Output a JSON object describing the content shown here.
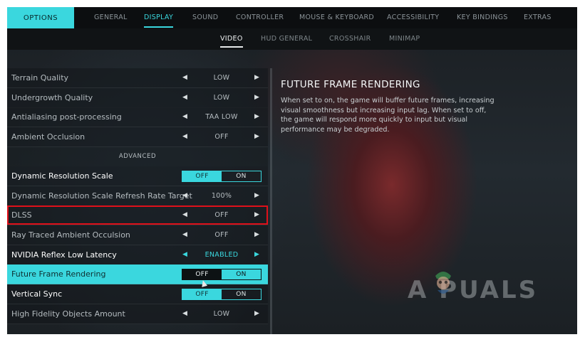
{
  "header": {
    "options_label": "OPTIONS",
    "tabs": [
      {
        "label": "GENERAL",
        "active": false
      },
      {
        "label": "DISPLAY",
        "active": true
      },
      {
        "label": "SOUND",
        "active": false
      },
      {
        "label": "CONTROLLER",
        "active": false
      },
      {
        "label": "MOUSE & KEYBOARD",
        "active": false
      },
      {
        "label": "ACCESSIBILITY",
        "active": false
      },
      {
        "label": "KEY BINDINGS",
        "active": false
      },
      {
        "label": "EXTRAS",
        "active": false
      }
    ],
    "subtabs": [
      {
        "label": "VIDEO",
        "active": true
      },
      {
        "label": "HUD GENERAL",
        "active": false
      },
      {
        "label": "CROSSHAIR",
        "active": false
      },
      {
        "label": "MINIMAP",
        "active": false
      }
    ]
  },
  "settings": {
    "terrain_quality": {
      "label": "Terrain Quality",
      "value": "LOW"
    },
    "undergrowth_quality": {
      "label": "Undergrowth Quality",
      "value": "LOW"
    },
    "antialiasing": {
      "label": "Antialiasing post-processing",
      "value": "TAA LOW"
    },
    "ambient_occlusion": {
      "label": "Ambient Occlusion",
      "value": "OFF"
    },
    "advanced_header": "ADVANCED",
    "dynamic_resolution_scale": {
      "label": "Dynamic Resolution Scale",
      "off": "OFF",
      "on": "ON",
      "selected": "OFF"
    },
    "drs_refresh_target": {
      "label": "Dynamic Resolution Scale Refresh Rate Target",
      "value": "100%"
    },
    "dlss": {
      "label": "DLSS",
      "value": "OFF"
    },
    "ray_traced_ao": {
      "label": "Ray Traced Ambient Occulsion",
      "value": "OFF"
    },
    "nvidia_reflex": {
      "label": "NVIDIA Reflex Low Latency",
      "value": "ENABLED"
    },
    "future_frame_rendering": {
      "label": "Future Frame Rendering",
      "off": "OFF",
      "on": "ON",
      "selected": "OFF"
    },
    "vertical_sync": {
      "label": "Vertical Sync",
      "off": "OFF",
      "on": "ON",
      "selected": "OFF"
    },
    "high_fidelity_objects": {
      "label": "High Fidelity Objects Amount",
      "value": "LOW"
    }
  },
  "info_panel": {
    "title": "FUTURE FRAME RENDERING",
    "description": "When set to on, the game will buffer future frames, increasing visual smoothness but increasing input lag. When set to off, the game will respond more quickly to input but visual performance may be degraded."
  },
  "watermark": {
    "text": "A  PUALS"
  },
  "colors": {
    "accent": "#3ad7de",
    "highlight_box": "#e0101a"
  }
}
